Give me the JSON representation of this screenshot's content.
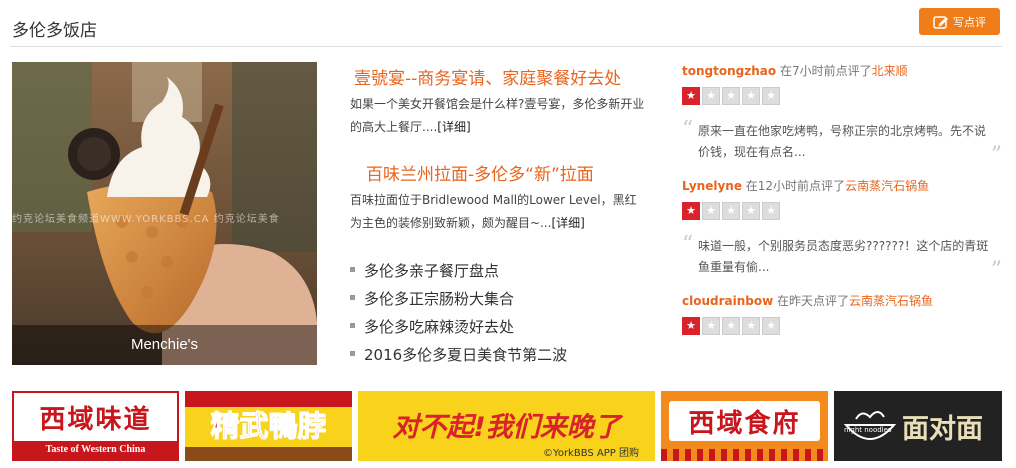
{
  "header": {
    "title": "多伦多饭店",
    "review_button": "写点评"
  },
  "hero": {
    "caption": "Menchie's",
    "watermark": "约克论坛美食频道WWW.YORKBBS.CA 约克论坛美食"
  },
  "articles": [
    {
      "title": "壹號宴--商务宴请、家庭聚餐好去处",
      "desc": "如果一个美女开餐馆会是什么样?壹号宴，多伦多新开业的高大上餐厅....",
      "more": "[详细]"
    },
    {
      "title": "百味兰州拉面-多伦多“新”拉面",
      "desc": "百味拉面位于Bridlewood Mall的Lower Level，黑红为主色的装修别致新颖，颇为醒目~...",
      "more": "[详细]"
    }
  ],
  "links": [
    "多伦多亲子餐厅盘点",
    "多伦多正宗肠粉大集合",
    "多伦多吃麻辣烫好去处",
    "2016多伦多夏日美食节第二波"
  ],
  "reviews": [
    {
      "user": "tongtongzhao",
      "meta": "在7小时前点评了",
      "place": "北来顺",
      "rating": 1,
      "max": 5,
      "text": "原来一直在他家吃烤鸭，号称正宗的北京烤鸭。先不说价钱，现在有点名..."
    },
    {
      "user": "Lynelyne",
      "meta": "在12小时前点评了",
      "place": "云南蒸汽石锅鱼",
      "rating": 1,
      "max": 5,
      "text": "味道一般，个别服务员态度恶劣??????！这个店的青斑鱼重量有偷..."
    },
    {
      "user": "cloudrainbow",
      "meta": "在昨天点评了",
      "place": "云南蒸汽石锅鱼",
      "rating": 1,
      "max": 5
    }
  ],
  "banners": {
    "b1": {
      "title": "西域味道",
      "sub": "Taste of Western China"
    },
    "b2": {
      "title": "精武鴨脖"
    },
    "b3": {
      "title": "对不起!我们来晚了",
      "footer": "©YorkBBS APP 团购"
    },
    "b4": {
      "title": "西域食府"
    },
    "b5": {
      "title": "面对面",
      "logo_text": "night noodles"
    }
  },
  "colors": {
    "accent": "#e9641c",
    "button": "#f07d1a",
    "star_on": "#d9222a",
    "banner_yellow": "#f8d21b",
    "banner_orange": "#f28a1c"
  }
}
